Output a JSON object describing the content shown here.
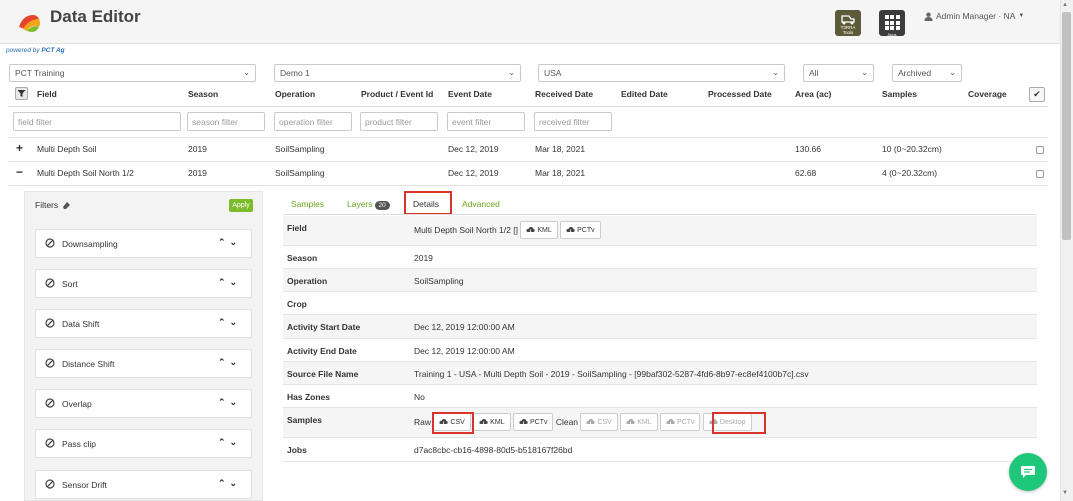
{
  "header": {
    "title": "Data Editor",
    "powered_by_prefix": "powered by",
    "powered_by_brand": "PCT Ag",
    "terra_label": "T3RRA Tools",
    "apps_label": "Apps",
    "user_label": "Admin Manager · NA"
  },
  "selects": {
    "account": "PCT Training",
    "project": "Demo 1",
    "country": "USA",
    "scope": "All",
    "status": "Archived"
  },
  "columns": [
    "Field",
    "Season",
    "Operation",
    "Product / Event Id",
    "Event Date",
    "Received Date",
    "Edited Date",
    "Processed Date",
    "Area (ac)",
    "Samples",
    "Coverage"
  ],
  "filter_placeholders": {
    "field": "field filter",
    "season": "season filter",
    "operation": "operation filter",
    "product": "product filter",
    "event": "event filter",
    "received": "received filter"
  },
  "rows": [
    {
      "expander": "+",
      "field": "Multi Depth Soil",
      "season": "2019",
      "operation": "SoilSampling",
      "event_date": "Dec 12, 2019",
      "received_date": "Mar 18, 2021",
      "area": "130.66",
      "samples": "10 (0~20.32cm)"
    },
    {
      "expander": "−",
      "field": "Multi Depth Soil North 1/2",
      "season": "2019",
      "operation": "SoilSampling",
      "event_date": "Dec 12, 2019",
      "received_date": "Mar 18, 2021",
      "area": "62.68",
      "samples": "4 (0~20.32cm)"
    }
  ],
  "filters_panel": {
    "title": "Filters",
    "apply": "Apply",
    "items": [
      "Downsampling",
      "Sort",
      "Data Shift",
      "Distance Shift",
      "Overlap",
      "Pass clip",
      "Sensor Drift"
    ]
  },
  "tabs": {
    "samples": "Samples",
    "layers": "Layers",
    "layers_count": "20",
    "details": "Details",
    "advanced": "Advanced"
  },
  "details": {
    "field_label": "Field",
    "field_value": "Multi Depth Soil North 1/2 []",
    "season_label": "Season",
    "season_value": "2019",
    "operation_label": "Operation",
    "operation_value": "SoilSampling",
    "crop_label": "Crop",
    "crop_value": "",
    "start_label": "Activity Start Date",
    "start_value": "Dec 12, 2019 12:00:00 AM",
    "end_label": "Activity End Date",
    "end_value": "Dec 12, 2019 12:00:00 AM",
    "source_label": "Source File Name",
    "source_value": "Training 1 - USA - Multi Depth Soil - 2019 - SoilSampling - [99baf302-5287-4fd6-8b97-ec8ef4100b7c].csv",
    "zones_label": "Has Zones",
    "zones_value": "No",
    "samples_label": "Samples",
    "raw_label": "Raw",
    "clean_label": "Clean",
    "jobs_label": "Jobs",
    "jobs_value": "d7ac8cbc-cb16-4898-80d5-b518167f26bd"
  },
  "buttons": {
    "kml": "KML",
    "pctv": "PCTv",
    "csv": "CSV",
    "desktop": "Desktop"
  },
  "colors": {
    "accent_green": "#7cbc2a",
    "highlight_red": "#d9342b",
    "chat_green": "#1fc77a"
  }
}
